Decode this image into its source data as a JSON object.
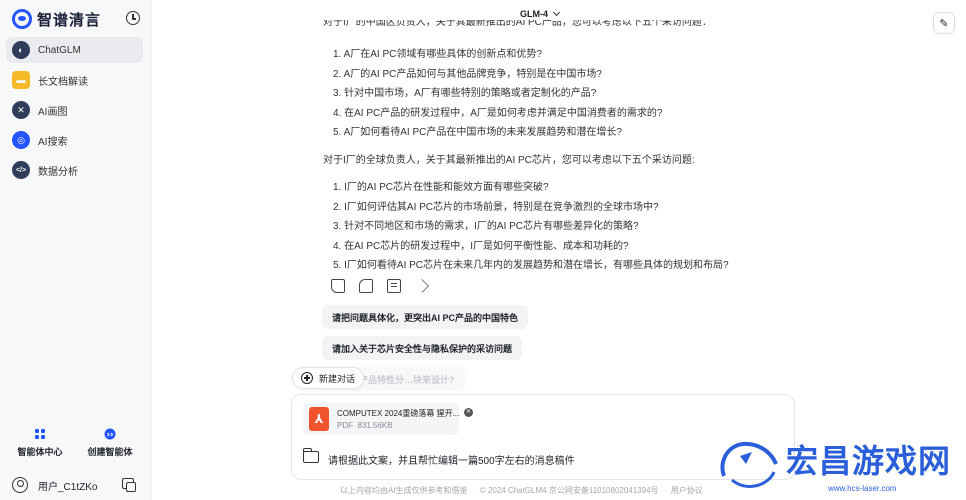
{
  "sidebar": {
    "logo_text": "智谱清言",
    "nav": [
      {
        "label": "ChatGLM",
        "icon": "chatglm-icon",
        "color": "#2f3d5a",
        "glyph": "◐",
        "active": true
      },
      {
        "label": "长文档解读",
        "icon": "document-folder-icon",
        "color": "#f6b928",
        "glyph": "▬",
        "active": false
      },
      {
        "label": "AI画图",
        "icon": "ai-drawing-icon",
        "color": "#2f3d5a",
        "glyph": "✕",
        "active": false
      },
      {
        "label": "AI搜索",
        "icon": "ai-search-icon",
        "color": "#2454ff",
        "glyph": "◎",
        "active": false
      },
      {
        "label": "数据分析",
        "icon": "data-analysis-icon",
        "color": "#2f3d5a",
        "glyph": "</>",
        "active": false
      }
    ],
    "agent_center": "智能体中心",
    "create_agent": "创建智能体",
    "user_name": "用户_C1tZKo"
  },
  "header": {
    "model": "GLM-4"
  },
  "chat": {
    "partial_line": "对于I厂的中国区负责人，关于其最新推出的AI PC产品，您可以考虑以下五个采访问题：",
    "list_a": [
      "1. A厂在AI PC领域有哪些具体的创新点和优势?",
      "2. A厂的AI PC产品如何与其他品牌竞争，特别是在中国市场?",
      "3. 针对中国市场，A厂有哪些特别的策略或者定制化的产品?",
      "4. 在AI PC产品的研发过程中，A厂是如何考虑并满足中国消费者的需求的?",
      "5. A厂如何看待AI PC产品在中国市场的未来发展趋势和潜在增长?"
    ],
    "intro_b": "对于I厂的全球负责人，关于其最新推出的AI PC芯片，您可以考虑以下五个采访问题:",
    "list_b": [
      "1. I厂的AI PC芯片在性能和能效方面有哪些突破?",
      "2. I厂如何评估其AI PC芯片的市场前景，特别是在竞争激烈的全球市场中?",
      "3. 针对不同地区和市场的需求，I厂的AI PC芯片有哪些差异化的策略?",
      "4. 在AI PC芯片的研发过程中，I厂是如何平衡性能、成本和功耗的?",
      "5. I厂如何看待AI PC芯片在未来几年内的发展趋势和潜在增长，有哪些具体的规划和布局?"
    ],
    "suggestions": [
      "请把问题具体化，更突出AI PC产品的中国特色",
      "请加入关于芯片安全性与隐私保护的采访问题",
      "能否按产品特性分…块来设计?"
    ],
    "new_chat": "新建对话"
  },
  "input": {
    "file_name": "COMPUTEX 2024重磅落幕 猩开...",
    "file_type": "PDF",
    "file_size": "831.56KB",
    "prompt": "请根据此文案，并且帮忙编辑一篇500字左右的消息稿件"
  },
  "footer": {
    "disclaimer": "以上内容均由AI生成仅供参考和借鉴",
    "copyright": "© 2024 ChatGLM4 京公网安备11010802041394号",
    "agreement": "用户协议"
  },
  "watermark": {
    "text": "宏昌游戏网",
    "url": "www.hcs-laser.com"
  }
}
